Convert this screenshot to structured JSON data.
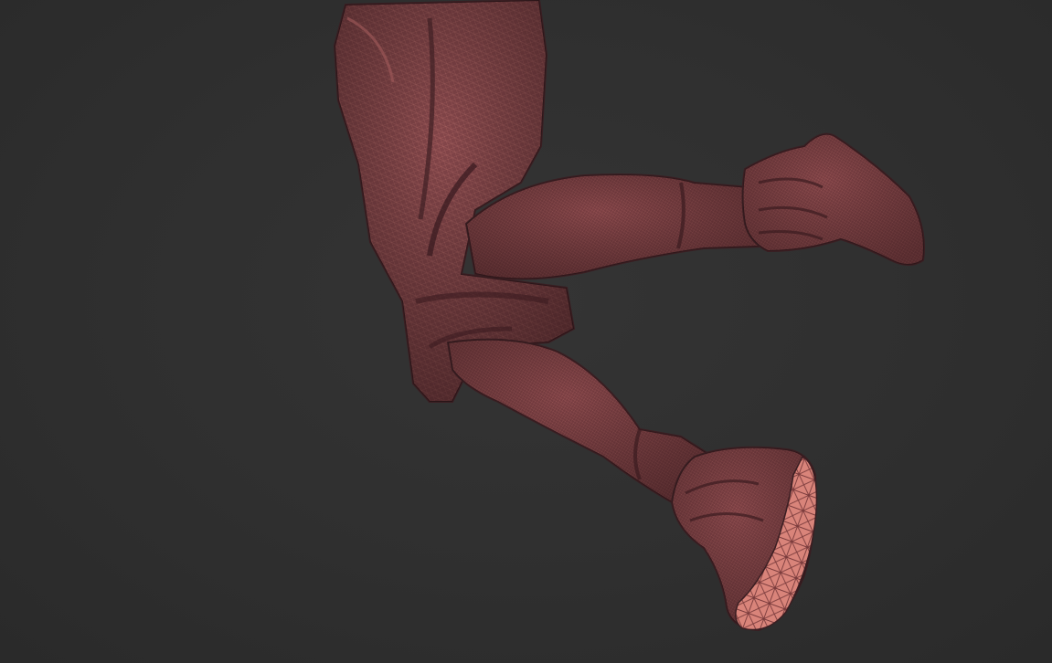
{
  "viewport": {
    "background_color": "#2f2f2f",
    "model_color": "#8a4a4c",
    "wireframe_color": "#c97a74",
    "shadow_color": "#3a1e22",
    "subject": "sculpted-legs-mesh-with-polyframe"
  }
}
